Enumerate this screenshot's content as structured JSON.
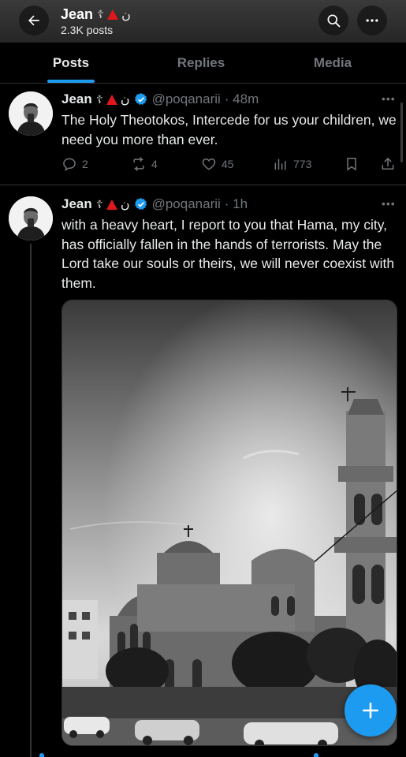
{
  "header": {
    "name": "Jean",
    "emoji_cross": "☦",
    "emoji_nun": "ن",
    "posts_count": "2.3K posts",
    "icons": [
      "back-arrow-icon",
      "search-icon",
      "more-icon"
    ]
  },
  "tabs": [
    {
      "label": "Posts",
      "active": true
    },
    {
      "label": "Replies",
      "active": false
    },
    {
      "label": "Media",
      "active": false
    }
  ],
  "posts": [
    {
      "name": "Jean",
      "emoji_cross": "☦",
      "emoji_nun": "ن",
      "handle": "@poqanarii",
      "time": "· 48m",
      "text": "The Holy Theotokos, Intercede for us your children, we need you more than ever.",
      "replies": "2",
      "reposts": "4",
      "likes": "45",
      "views": "773"
    },
    {
      "name": "Jean",
      "emoji_cross": "☦",
      "emoji_nun": "ن",
      "handle": "@poqanarii",
      "time": "· 1h",
      "text": "with a heavy heart, I report to you that Hama, my city, has officially fallen in the hands of terrorists. May the Lord take our souls or theirs, we will never coexist with them."
    }
  ],
  "menu_dots": "•••",
  "colors": {
    "accent": "#1d9bf0",
    "muted": "#71767b",
    "text": "#e7e9ea",
    "divider": "#2f3336",
    "red_triangle": "#e0181b"
  }
}
